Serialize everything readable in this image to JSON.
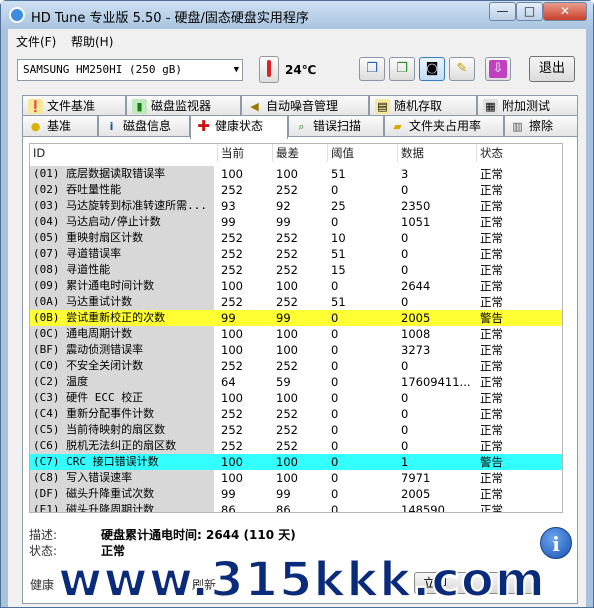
{
  "window": {
    "title": "HD Tune 专业版 5.50 - 硬盘/固态硬盘实用程序",
    "minimize": "—",
    "maximize": "□",
    "close": "✕"
  },
  "menu": [
    {
      "label": "文件(F)"
    },
    {
      "label": "帮助(H)"
    }
  ],
  "toolbar": {
    "drive": "SAMSUNG HM250HI (250 gB)",
    "temperature": "24℃",
    "exit_label": "退出",
    "buttons": [
      "copy-icon",
      "copy-all-icon",
      "camera-icon",
      "options-icon",
      "save-icon"
    ]
  },
  "tabs_top": [
    {
      "label": "文件基准",
      "icon": "file-benchmark-icon"
    },
    {
      "label": "磁盘监视器",
      "icon": "disk-monitor-icon"
    },
    {
      "label": "自动噪音管理",
      "icon": "aam-icon"
    },
    {
      "label": "随机存取",
      "icon": "random-access-icon"
    },
    {
      "label": "附加测试",
      "icon": "extra-tests-icon"
    }
  ],
  "tabs_bottom": [
    {
      "label": "基准",
      "icon": "benchmark-icon"
    },
    {
      "label": "磁盘信息",
      "icon": "info-icon"
    },
    {
      "label": "健康状态",
      "icon": "health-icon",
      "active": true
    },
    {
      "label": "错误扫描",
      "icon": "error-scan-icon"
    },
    {
      "label": "文件夹占用率",
      "icon": "folder-usage-icon"
    },
    {
      "label": "擦除",
      "icon": "erase-icon"
    }
  ],
  "table": {
    "headers": [
      "ID",
      "当前",
      "最差",
      "阈值",
      "数据",
      "状态"
    ],
    "rows": [
      {
        "id": "(01) 底层数据读取错误率",
        "cur": "100",
        "worst": "100",
        "thr": "51",
        "data": "3",
        "status": "正常"
      },
      {
        "id": "(02) 吞吐量性能",
        "cur": "252",
        "worst": "252",
        "thr": "0",
        "data": "0",
        "status": "正常"
      },
      {
        "id": "(03) 马达旋转到标准转速所需...",
        "cur": "93",
        "worst": "92",
        "thr": "25",
        "data": "2350",
        "status": "正常"
      },
      {
        "id": "(04) 马达启动/停止计数",
        "cur": "99",
        "worst": "99",
        "thr": "0",
        "data": "1051",
        "status": "正常"
      },
      {
        "id": "(05) 重映射扇区计数",
        "cur": "252",
        "worst": "252",
        "thr": "10",
        "data": "0",
        "status": "正常"
      },
      {
        "id": "(07) 寻道错误率",
        "cur": "252",
        "worst": "252",
        "thr": "51",
        "data": "0",
        "status": "正常"
      },
      {
        "id": "(08) 寻道性能",
        "cur": "252",
        "worst": "252",
        "thr": "15",
        "data": "0",
        "status": "正常"
      },
      {
        "id": "(09) 累计通电时间计数",
        "cur": "100",
        "worst": "100",
        "thr": "0",
        "data": "2644",
        "status": "正常"
      },
      {
        "id": "(0A) 马达重试计数",
        "cur": "252",
        "worst": "252",
        "thr": "51",
        "data": "0",
        "status": "正常"
      },
      {
        "id": "(0B) 尝试重新校正的次数",
        "cur": "99",
        "worst": "99",
        "thr": "0",
        "data": "2005",
        "status": "警告",
        "highlight": "yellow"
      },
      {
        "id": "(0C) 通电周期计数",
        "cur": "100",
        "worst": "100",
        "thr": "0",
        "data": "1008",
        "status": "正常"
      },
      {
        "id": "(BF) 震动侦测错误率",
        "cur": "100",
        "worst": "100",
        "thr": "0",
        "data": "3273",
        "status": "正常"
      },
      {
        "id": "(C0) 不安全关闭计数",
        "cur": "252",
        "worst": "252",
        "thr": "0",
        "data": "0",
        "status": "正常"
      },
      {
        "id": "(C2) 温度",
        "cur": "64",
        "worst": "59",
        "thr": "0",
        "data": "17609411...",
        "status": "正常"
      },
      {
        "id": "(C3) 硬件 ECC 校正",
        "cur": "100",
        "worst": "100",
        "thr": "0",
        "data": "0",
        "status": "正常"
      },
      {
        "id": "(C4) 重新分配事件计数",
        "cur": "252",
        "worst": "252",
        "thr": "0",
        "data": "0",
        "status": "正常"
      },
      {
        "id": "(C5) 当前待映射的扇区数",
        "cur": "252",
        "worst": "252",
        "thr": "0",
        "data": "0",
        "status": "正常"
      },
      {
        "id": "(C6) 脱机无法纠正的扇区数",
        "cur": "252",
        "worst": "252",
        "thr": "0",
        "data": "0",
        "status": "正常"
      },
      {
        "id": "(C7) CRC 接口错误计数",
        "cur": "100",
        "worst": "100",
        "thr": "0",
        "data": "1",
        "status": "警告",
        "highlight": "cyan"
      },
      {
        "id": "(C8) 写入错误速率",
        "cur": "100",
        "worst": "100",
        "thr": "0",
        "data": "7971",
        "status": "正常"
      },
      {
        "id": "(DF) 磁头升降重试次数",
        "cur": "99",
        "worst": "99",
        "thr": "0",
        "data": "2005",
        "status": "正常"
      },
      {
        "id": "(E1) 磁头升降周期计数",
        "cur": "86",
        "worst": "86",
        "thr": "0",
        "data": "148590",
        "status": "正常"
      }
    ]
  },
  "description": {
    "label": "描述:",
    "text": "硬盘累计通电时间: 2644 (110 天)"
  },
  "status": {
    "label": "状态:",
    "text": "正常"
  },
  "bottom": {
    "health_label": "健康",
    "refresh_label": "刷新",
    "update_label": "立即"
  },
  "watermark": "www.315kkk.com"
}
